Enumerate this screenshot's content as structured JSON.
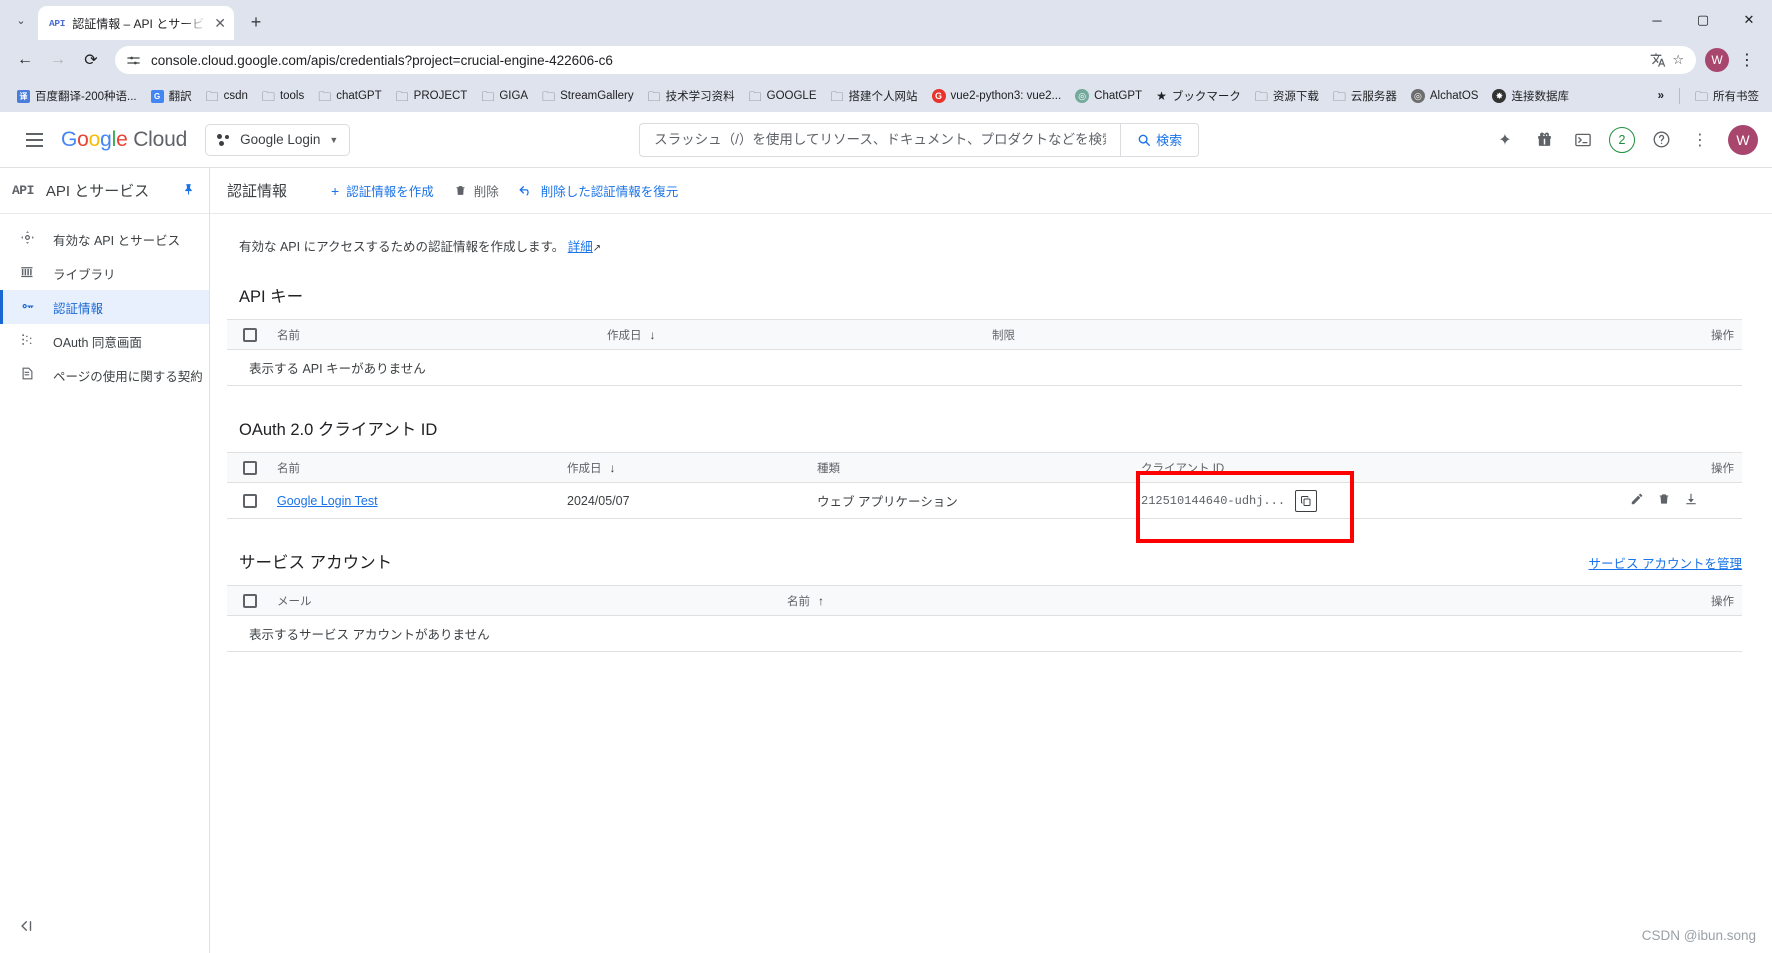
{
  "browser": {
    "tab": {
      "favicon_label": "API",
      "title": "認証情報 – API とサービス – Goog",
      "close_icon": "✕",
      "newtab_icon": "+",
      "list_icon": "⌄"
    },
    "window_controls": {
      "minimize": "─",
      "maximize": "▢",
      "close": "✕"
    },
    "nav": {
      "back_icon": "←",
      "forward_icon": "→",
      "reload_icon": "⟳",
      "site_info_icon": "site-settings-icon",
      "url": "console.cloud.google.com/apis/credentials?project=crucial-engine-422606-c6",
      "translate_icon": "translate-icon",
      "bookmark_star_icon": "☆",
      "profile_initial": "W",
      "menu_icon": "⋮"
    },
    "bookmarks": [
      {
        "label": "百度翻译-200种语...",
        "icon": "translate-square",
        "color": "#4a7ddc",
        "glyph": "译"
      },
      {
        "label": "翻訳",
        "icon": "translate-square",
        "color": "#4285f4",
        "glyph": "G"
      },
      {
        "label": "csdn",
        "icon": "folder"
      },
      {
        "label": "tools",
        "icon": "folder"
      },
      {
        "label": "chatGPT",
        "icon": "folder"
      },
      {
        "label": "PROJECT",
        "icon": "folder"
      },
      {
        "label": "GIGA",
        "icon": "folder"
      },
      {
        "label": "StreamGallery",
        "icon": "folder"
      },
      {
        "label": "技术学习资料",
        "icon": "folder"
      },
      {
        "label": "GOOGLE",
        "icon": "folder"
      },
      {
        "label": "搭建个人网站",
        "icon": "folder"
      },
      {
        "label": "vue2-python3: vue2...",
        "icon": "circle",
        "color": "#e8322a",
        "glyph": "G"
      },
      {
        "label": "ChatGPT",
        "icon": "circle",
        "color": "#74aa9c",
        "glyph": "◎"
      },
      {
        "label": "ブックマーク",
        "icon": "star",
        "glyph": "★"
      },
      {
        "label": "资源下载",
        "icon": "folder"
      },
      {
        "label": "云服务器",
        "icon": "folder"
      },
      {
        "label": "AlchatOS",
        "icon": "circle",
        "color": "#6e6e6e",
        "glyph": "◎"
      },
      {
        "label": "连接数据库",
        "icon": "circle",
        "color": "#333333",
        "glyph": "✸"
      }
    ],
    "bookmarks_overflow_icon": "»",
    "all_bookmarks_label": "所有书签"
  },
  "gc_header": {
    "logo_google": [
      "G",
      "o",
      "o",
      "g",
      "l",
      "e"
    ],
    "logo_cloud": "Cloud",
    "project_name": "Google Login",
    "search_placeholder": "スラッシュ（/）を使用してリソース、ドキュメント、プロダクトなどを検索",
    "search_button_label": "検索",
    "notification_count": "2",
    "user_initial": "W"
  },
  "sidebar": {
    "api_icon_label": "API",
    "title": "API とサービス",
    "pin_icon": "pin-icon",
    "items": [
      {
        "label": "有効な API とサービス",
        "icon": "dashboard-icon",
        "active": false
      },
      {
        "label": "ライブラリ",
        "icon": "library-icon",
        "active": false
      },
      {
        "label": "認証情報",
        "icon": "key-icon",
        "active": true
      },
      {
        "label": "OAuth 同意画面",
        "icon": "consent-icon",
        "active": false
      },
      {
        "label": "ページの使用に関する契約",
        "icon": "agreement-icon",
        "active": false
      }
    ],
    "collapse_icon": "◁|"
  },
  "main": {
    "toolbar": {
      "title": "認証情報",
      "create_label": "認証情報を作成",
      "create_icon": "+",
      "delete_label": "削除",
      "delete_icon": "🗑",
      "restore_label": "削除した認証情報を復元",
      "restore_icon": "↰"
    },
    "description": "有効な API にアクセスするための認証情報を作成します。",
    "description_link": "詳細",
    "sections": [
      {
        "id": "api-keys",
        "title": "API キー",
        "columns": [
          "名前",
          "作成日",
          "制限",
          "操作"
        ],
        "sort_column_index": 1,
        "sort_arrow": "↓",
        "empty_message": "表示する API キーがありません",
        "rows": []
      },
      {
        "id": "oauth-clients",
        "title": "OAuth 2.0 クライアント ID",
        "columns": [
          "名前",
          "作成日",
          "種類",
          "クライアント ID",
          "操作"
        ],
        "sort_column_index": 1,
        "sort_arrow": "↓",
        "rows": [
          {
            "name": "Google Login Test",
            "created": "2024/05/07",
            "type": "ウェブ アプリケーション",
            "client_id": "212510144640-udhj...",
            "actions": [
              "edit-icon",
              "delete-icon",
              "download-icon"
            ]
          }
        ]
      },
      {
        "id": "service-accounts",
        "title": "サービス アカウント",
        "manage_link": "サービス アカウントを管理",
        "columns": [
          "メール",
          "名前",
          "操作"
        ],
        "sort_column_index": 1,
        "sort_arrow": "↑",
        "empty_message": "表示するサービス アカウントがありません",
        "rows": []
      }
    ],
    "copy_button_icon": "copy-icon"
  },
  "watermark": "CSDN @ibun.song"
}
